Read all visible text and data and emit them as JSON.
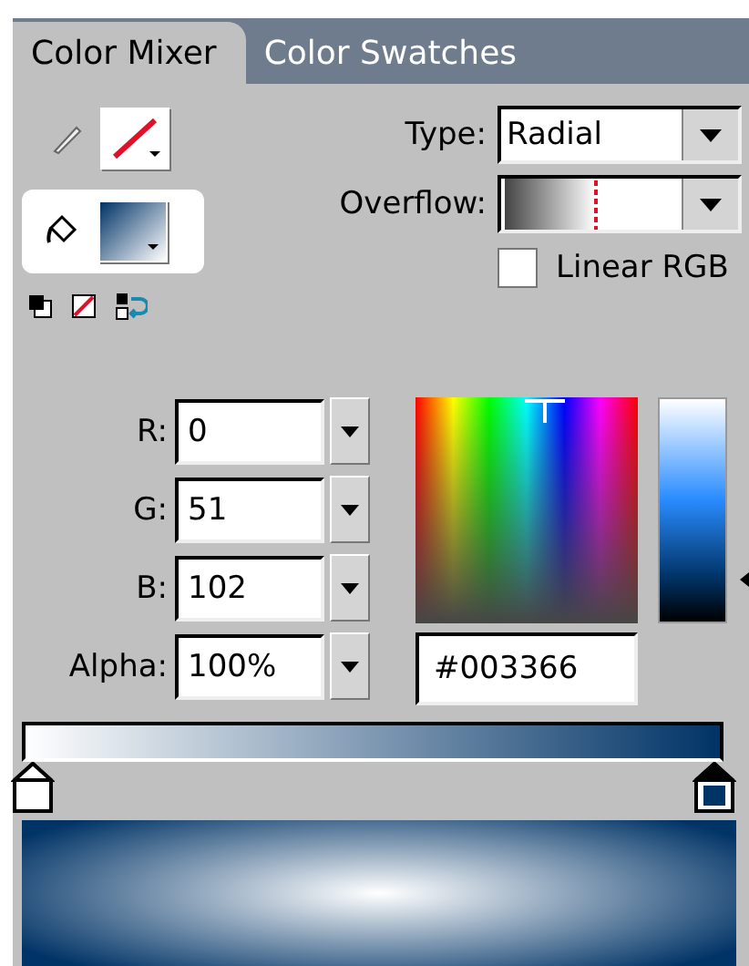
{
  "tabs": [
    {
      "label": "Color Mixer",
      "selected": true
    },
    {
      "label": "Color Swatches",
      "selected": false
    }
  ],
  "type": {
    "label": "Type:",
    "value": "Radial"
  },
  "overflow": {
    "label": "Overflow:"
  },
  "linear_rgb": {
    "label": "Linear RGB",
    "checked": false
  },
  "channels": [
    {
      "label": "R:",
      "value": "0"
    },
    {
      "label": "G:",
      "value": "51"
    },
    {
      "label": "B:",
      "value": "102"
    },
    {
      "label": "Alpha:",
      "value": "100%"
    }
  ],
  "hex": {
    "value": "#003366"
  },
  "gradient_stops": [
    {
      "color": "#ffffff",
      "selected": false
    },
    {
      "color": "#003366",
      "selected": true
    }
  ]
}
